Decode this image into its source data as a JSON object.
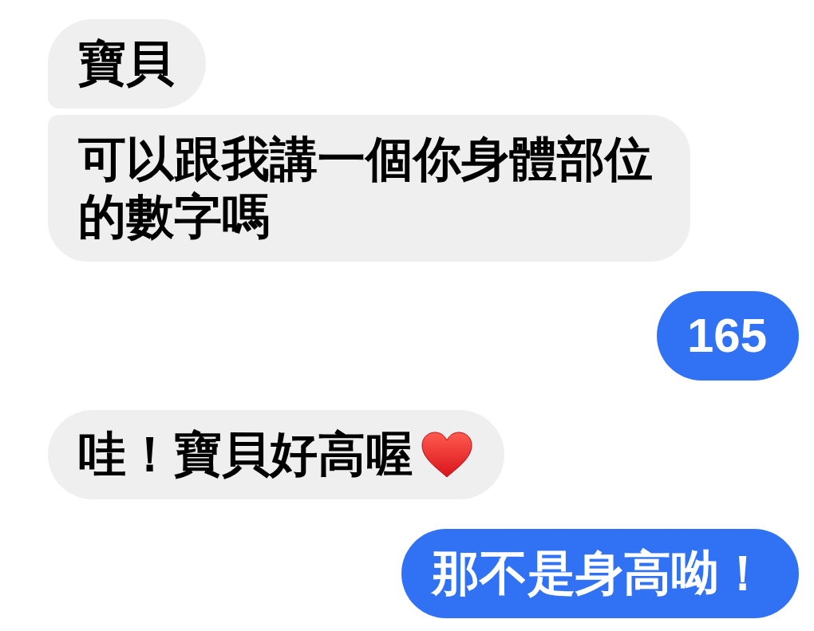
{
  "messages": [
    {
      "outgoing": false,
      "kind": "plain",
      "text": "寶貝"
    },
    {
      "outgoing": false,
      "kind": "plain",
      "text": "可以跟我講一個你身體部位的數字嗎"
    },
    {
      "outgoing": true,
      "kind": "plain",
      "text": "165"
    },
    {
      "outgoing": false,
      "kind": "hearted",
      "text": "哇！寶貝好高喔"
    },
    {
      "outgoing": true,
      "kind": "plain",
      "text": "那不是身高呦！"
    }
  ]
}
